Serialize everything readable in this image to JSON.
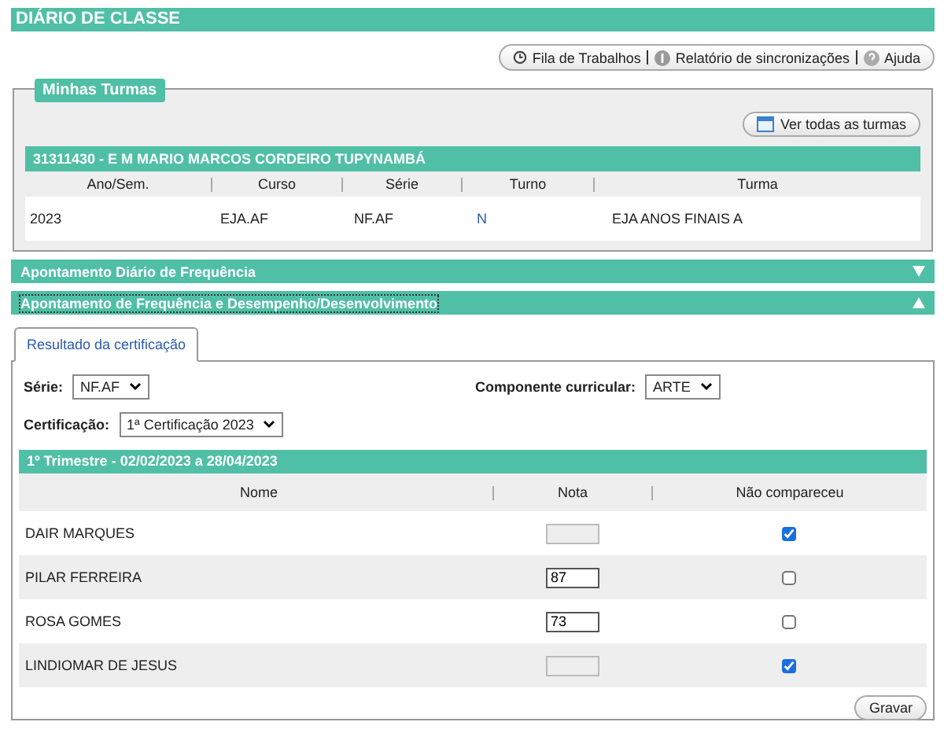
{
  "header": {
    "title": "DIÁRIO DE CLASSE"
  },
  "toolbar": [
    {
      "kind": "clock",
      "label": "Fila de Trabalhos"
    },
    {
      "kind": "info",
      "label": "Relatório de sincronizações"
    },
    {
      "kind": "help",
      "label": "Ajuda"
    }
  ],
  "minhas_turmas": {
    "legend": "Minhas Turmas",
    "button": "Ver todas as turmas",
    "school": "31311430 - E M MARIO MARCOS CORDEIRO TUPYNAMBÁ",
    "columns": [
      "Ano/Sem.",
      "Curso",
      "Série",
      "Turno",
      "Turma"
    ],
    "rows": [
      {
        "cells": [
          "2023",
          "EJA.AF",
          "NF.AF",
          "N",
          "EJA ANOS FINAIS A"
        ]
      }
    ]
  },
  "sections": [
    {
      "title": "Apontamento Diário de Frequência",
      "expanded": false
    },
    {
      "title": "Apontamento de Frequência e Desempenho/Desenvolvimento",
      "expanded": true
    }
  ],
  "tabs": [
    {
      "label": "Resultado da certificação",
      "selected": true
    }
  ],
  "filters": {
    "serie": {
      "label": "Série:",
      "value": "NF.AF"
    },
    "componente": {
      "label": "Componente curricular:",
      "value": "ARTE"
    },
    "certificacao": {
      "label": "Certificação:",
      "value": "1ª Certificação 2023"
    }
  },
  "period": "1º Trimestre - 02/02/2023 a 28/04/2023",
  "grades": {
    "columns": [
      "Nome",
      "Nota",
      "Não compareceu"
    ],
    "rows": [
      {
        "name": "DAIR MARQUES",
        "grade": "",
        "disabled": true,
        "absent": true
      },
      {
        "name": "PILAR FERREIRA",
        "grade": "87",
        "disabled": false,
        "absent": false
      },
      {
        "name": "ROSA GOMES",
        "grade": "73",
        "disabled": false,
        "absent": false
      },
      {
        "name": "LINDIOMAR DE JESUS",
        "grade": "",
        "disabled": true,
        "absent": true
      }
    ]
  },
  "save_button": "Gravar"
}
